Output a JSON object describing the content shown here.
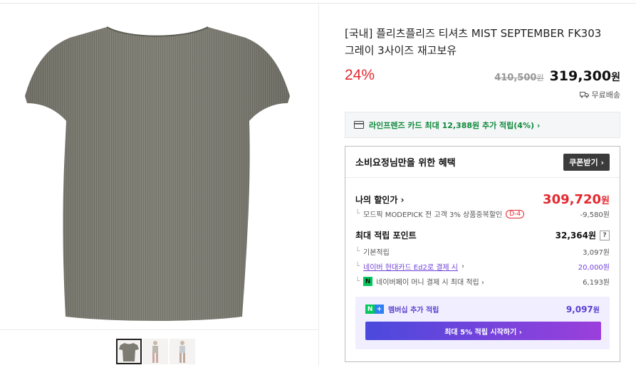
{
  "product": {
    "title_line1": "[국내] 플리츠플리즈 티셔츠 MIST SEPTEMBER FK303",
    "title_line2": "그레이 3사이즈 재고보유",
    "discount": "24%",
    "original_price": "410,500",
    "final_price": "319,300",
    "won": "원",
    "shipping": "무료배송",
    "color_swatch": "#7d7c72"
  },
  "card_banner": {
    "text": "라인프렌즈 카드 최대 12,388원 추가 적립(4%) ›"
  },
  "benefit": {
    "title": "소비요정님만을 위한 혜택",
    "coupon_button": "쿠폰받기 ›",
    "my_price_label": "나의 할인가 ›",
    "my_price_value": "309,720",
    "modepick_label": "모드픽 MODEPICK 전 고객 3% 상품중복할인",
    "modepick_badge": "D-4",
    "modepick_value": "-9,580원",
    "points_label": "최대 적립 포인트",
    "points_value": "32,364원",
    "points_help": "?",
    "basic_label": "기본적립",
    "basic_value": "3,097원",
    "naver_card_label": "네이버 현대카드 Ed2로 결제 시",
    "naver_card_chevron": "›",
    "naver_card_value": "20,000원",
    "npay_label": "네이버페이 머니 결제 시 최대 적립 ›",
    "npay_value": "6,193원",
    "member_label": "멤버십 추가 적립",
    "member_value": "9,097",
    "member_button": "최대 5% 적립 시작하기 ›"
  },
  "colors": {
    "accent_red": "#e4282f",
    "accent_green": "#0f8a3c",
    "accent_purple": "#5a3fd0",
    "naver_green": "#03c75a"
  }
}
